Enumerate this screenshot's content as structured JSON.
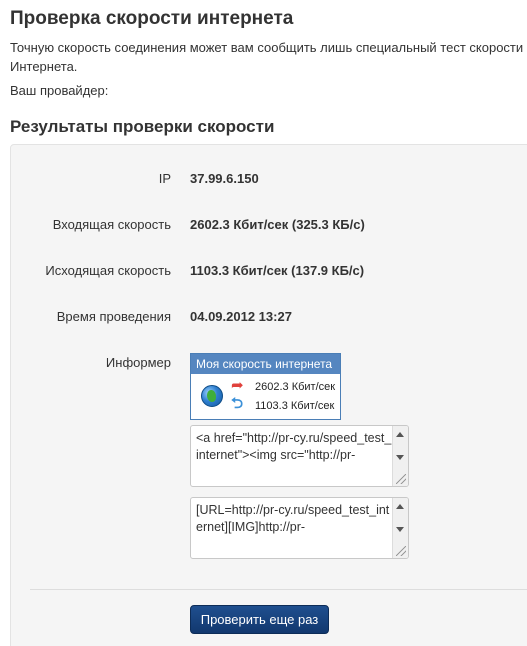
{
  "header": {
    "title": "Проверка скорости интернета",
    "intro": "Точную скорость соединения может вам сообщить лишь специальный тест скорости п",
    "intro_line2": "Интернета.",
    "provider_label": "Ваш провайдер:"
  },
  "results": {
    "title": "Результаты проверки скорости",
    "rows": [
      {
        "label": "IP",
        "value": "37.99.6.150"
      },
      {
        "label": "Входящая скорость",
        "value": "2602.3 Кбит/сек (325.3 КБ/с)"
      },
      {
        "label": "Исходящая скорость",
        "value": "1103.3 Кбит/сек (137.9 КБ/с)"
      },
      {
        "label": "Время проведения",
        "value": "04.09.2012 13:27"
      }
    ],
    "informer_label": "Информер"
  },
  "informer": {
    "title": "Моя скорость интернета",
    "download": "2602.3 Кбит/сек",
    "upload": "1103.3 Кбит/сек"
  },
  "code_boxes": {
    "html_code": "<a href=\"http://pr-cy.ru/speed_test_internet\"><img src=\"http://pr-",
    "bb_code": "[URL=http://pr-cy.ru/speed_test_internet][IMG]http://pr-"
  },
  "actions": {
    "check_again": "Проверить еще раз"
  },
  "colors": {
    "button": "#1a4580",
    "informer_header": "#5586c0",
    "panel_bg": "#f5f5f5"
  }
}
